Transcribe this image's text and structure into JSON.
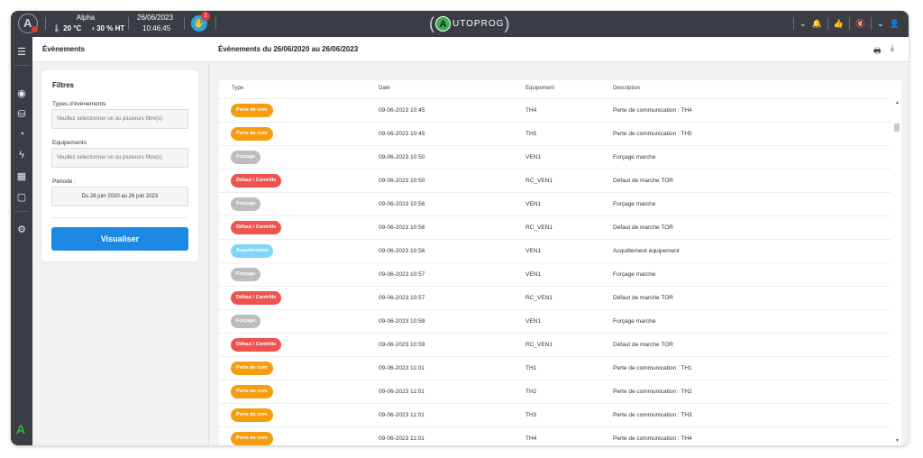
{
  "topbar": {
    "site_name": "Alpha",
    "temperature": "20 °C",
    "humidity": "30 % HT",
    "date": "26/06/2023",
    "time": "10:46:45",
    "notification_count": "1",
    "brand_letter": "A",
    "brand_text": "UTOPROG"
  },
  "sidebar": {
    "items": [
      "menu-icon",
      "eye-icon",
      "database-icon",
      "gauge-icon",
      "bolt-icon",
      "calendar-icon",
      "clipboard-icon",
      "settings-icon"
    ],
    "logo": "A"
  },
  "left_panel": {
    "title": "Évènements",
    "filters_title": "Filtres",
    "event_types_label": "Types d'évènements",
    "event_types_placeholder": "Veuillez sélectionner un ou plusieurs filtre(s)",
    "equipment_label": "Equipements",
    "equipment_placeholder": "Veuillez sélectionner un ou plusieurs filtre(s)",
    "period_label": "Période :",
    "period_value": "Du 26 juin 2020 au 26 juin 2023",
    "submit_label": "Visualiser"
  },
  "main": {
    "title": "Évènements du 26/06/2020 au 26/06/2023",
    "columns": [
      "Type",
      "Date",
      "Equipement",
      "Description"
    ],
    "tag_colors": {
      "Perte de com": "#f59d0e",
      "Forçage": "#bdbdbd",
      "Défaut / Contrôle": "#ef5350",
      "Acquittement": "#81d4fa"
    },
    "rows": [
      {
        "type": "Perte de com",
        "date": "09-06-2023 10:45",
        "equipment": "TH4",
        "description": "Perte de communication : TH4"
      },
      {
        "type": "Perte de com",
        "date": "09-06-2023 10:45",
        "equipment": "TH5",
        "description": "Perte de communication : TH5"
      },
      {
        "type": "Forçage",
        "date": "09-06-2023 10:50",
        "equipment": "VEN1",
        "description": "Forçage marche"
      },
      {
        "type": "Défaut / Contrôle",
        "date": "09-06-2023 10:50",
        "equipment": "RC_VEN1",
        "description": "Défaut de marche TOR"
      },
      {
        "type": "Forçage",
        "date": "09-06-2023 10:56",
        "equipment": "VEN1",
        "description": "Forçage marche"
      },
      {
        "type": "Défaut / Contrôle",
        "date": "09-06-2023 10:56",
        "equipment": "RC_VEN1",
        "description": "Défaut de marche TOR"
      },
      {
        "type": "Acquittement",
        "date": "09-06-2023 10:56",
        "equipment": "VEN1",
        "description": "Acquittement équipement"
      },
      {
        "type": "Forçage",
        "date": "09-06-2023 10:57",
        "equipment": "VEN1",
        "description": "Forçage marche"
      },
      {
        "type": "Défaut / Contrôle",
        "date": "09-06-2023 10:57",
        "equipment": "RC_VEN1",
        "description": "Défaut de marche TOR"
      },
      {
        "type": "Forçage",
        "date": "09-06-2023 10:59",
        "equipment": "VEN1",
        "description": "Forçage marche"
      },
      {
        "type": "Défaut / Contrôle",
        "date": "09-06-2023 10:59",
        "equipment": "RC_VEN1",
        "description": "Défaut de marche TOR"
      },
      {
        "type": "Perte de com",
        "date": "09-06-2023 11:01",
        "equipment": "TH1",
        "description": "Perte de communication : TH1"
      },
      {
        "type": "Perte de com",
        "date": "09-06-2023 11:01",
        "equipment": "TH2",
        "description": "Perte de communication : TH2"
      },
      {
        "type": "Perte de com",
        "date": "09-06-2023 11:01",
        "equipment": "TH3",
        "description": "Perte de communication : TH3"
      },
      {
        "type": "Perte de com",
        "date": "09-06-2023 11:01",
        "equipment": "TH4",
        "description": "Perte de communication : TH4"
      }
    ]
  }
}
